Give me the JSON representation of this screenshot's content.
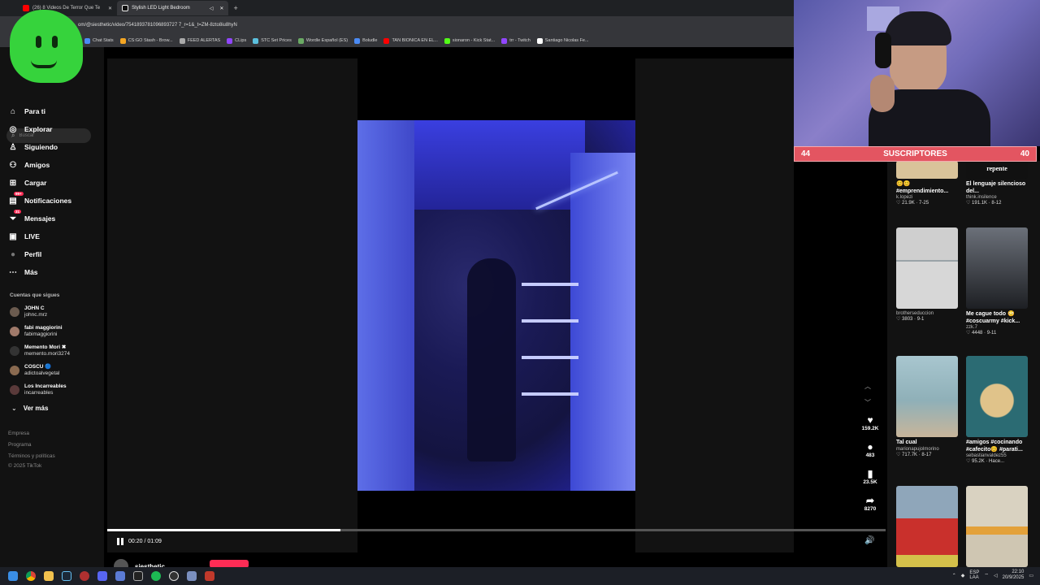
{
  "browser": {
    "tabs": [
      {
        "label": "(26) 8 Videos De Terror Que Te",
        "active": false,
        "color": "#ff0000"
      },
      {
        "label": "Stylish LED Light Bedroom",
        "active": true,
        "color": "#ffffff"
      }
    ],
    "new_tab": "+",
    "url": "om/@siesthetic/video/7541893781096893727 7_r=1&_t=ZM-8zto8iu8hyN",
    "bookmarks": [
      {
        "label": "Chat Stats",
        "color": "#4b8bf5"
      },
      {
        "label": "CS:GO Stash - Brow...",
        "color": "#f5a623"
      },
      {
        "label": "FEED ALERTAS",
        "color": "#aaaaaa"
      },
      {
        "label": "CLips",
        "color": "#9146ff"
      },
      {
        "label": "STC Set Prices",
        "color": "#5bc0de"
      },
      {
        "label": "Wordle Español (ES)",
        "color": "#6aaa64"
      },
      {
        "label": "Boludle",
        "color": "#4b8bf5"
      },
      {
        "label": "TAN BIONICA EN EL...",
        "color": "#ff0000"
      },
      {
        "label": "sionaron - Kick Stat...",
        "color": "#53fc18"
      },
      {
        "label": "trr - Twitch",
        "color": "#9146ff"
      },
      {
        "label": "Santiago Nicolas Fe...",
        "color": "#ffffff"
      }
    ]
  },
  "sidebar": {
    "search_placeholder": "Buscar",
    "nav": [
      {
        "label": "Para ti",
        "icon": "home-icon",
        "glyph": "⌂"
      },
      {
        "label": "Explorar",
        "icon": "compass-icon",
        "glyph": "◎"
      },
      {
        "label": "Siguiendo",
        "icon": "following-icon",
        "glyph": "♙"
      },
      {
        "label": "Amigos",
        "icon": "friends-icon",
        "glyph": "⚇"
      },
      {
        "label": "Cargar",
        "icon": "upload-icon",
        "glyph": "⊞"
      },
      {
        "label": "Notificaciones",
        "icon": "bell-icon",
        "glyph": "▤",
        "badge": "99+"
      },
      {
        "label": "Mensajes",
        "icon": "message-icon",
        "glyph": "⏷",
        "badge": "31"
      },
      {
        "label": "LIVE",
        "icon": "live-icon",
        "glyph": "▣"
      },
      {
        "label": "Perfil",
        "icon": "profile-icon",
        "glyph": "●"
      },
      {
        "label": "Más",
        "icon": "more-icon",
        "glyph": "⋯"
      }
    ],
    "following_title": "Cuentas que sigues",
    "accounts": [
      {
        "name": "JOHN C",
        "handle": "johnc.mrz"
      },
      {
        "name": "fabi maggiorini",
        "handle": "fabimaggiorini"
      },
      {
        "name": "Memento Mori ✖",
        "handle": "memento.mori3274"
      },
      {
        "name": "COSCU 🔵",
        "handle": "adictoalvegetal"
      },
      {
        "name": "Los Incarreables",
        "handle": "incarreables"
      }
    ],
    "see_more": "Ver más",
    "footer": [
      "Empresa",
      "Programa",
      "Términos y políticas",
      "© 2025 TikTok"
    ]
  },
  "player": {
    "time": "00:20 / 01:09",
    "progress": 0.3,
    "author": "siesthetic"
  },
  "actions": {
    "likes": "159.2K",
    "comments": "483",
    "saves": "23.5K",
    "shares": "8270"
  },
  "recommendations": [
    {
      "caption": "😊😊 #emprendimiento...",
      "author": "k.lopezi",
      "stats": "♡ 21.9K · 7-25",
      "thumb": "#d9c39a"
    },
    {
      "caption": "El lenguaje silencioso del...",
      "author": "think.insilence",
      "stats": "♡ 191.1K · 8-12",
      "thumb": "#111111",
      "thumb_text": "repente"
    },
    {
      "caption": "",
      "author": "brotherseduccion",
      "stats": "♡ 3803 · 9-1",
      "thumb": "#cfcfcf"
    },
    {
      "caption": "Me cague todo 😳 #coscuarmy #kick...",
      "author": "zzk.7",
      "stats": "♡ 4448 · 9-11",
      "thumb": "#4a4f57"
    },
    {
      "caption": "Tal cual",
      "author": "marionapujolmorino",
      "stats": "♡ 717.7K · 8-17",
      "thumb": "#9fc1c9"
    },
    {
      "caption": "#amigos #cocinando #cafecito😊 #parati...",
      "author": "sebastianvaldez55",
      "stats": "♡ 95.2K · Hace...",
      "thumb": "#2b6b73"
    },
    {
      "caption": "",
      "author": "",
      "stats": "",
      "thumb": "#8fa6ba"
    },
    {
      "caption": "",
      "author": "",
      "stats": "",
      "thumb": "#d9d2c1"
    }
  ],
  "overlay": {
    "sub_left": "44",
    "sub_label": "SUSCRIPTORES",
    "sub_right": "40"
  },
  "taskbar": {
    "lang": "ESP\nLAA",
    "time": "22:10",
    "date": "20/9/2025"
  }
}
